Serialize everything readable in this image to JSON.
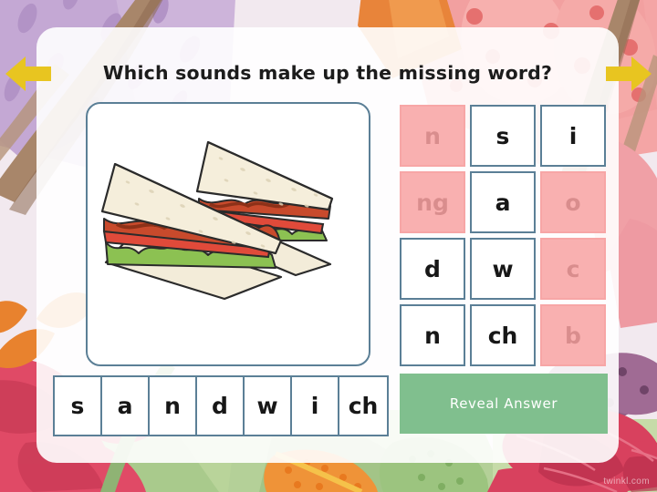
{
  "header": {
    "title": "Which sounds make up the missing word?"
  },
  "navigation": {
    "previous_label": "◀",
    "next_label": "▶"
  },
  "picture": {
    "alt": "sandwich",
    "description": "Two triangular halves of a BLT sandwich with lettuce, tomato and bacon"
  },
  "answer_row": {
    "word": "sandwich",
    "phonemes": [
      "s",
      "a",
      "n",
      "d",
      "w",
      "i",
      "ch"
    ]
  },
  "phoneme_grid": {
    "columns": 3,
    "rows": 4,
    "tiles": [
      {
        "label": "n",
        "state": "pink"
      },
      {
        "label": "s",
        "state": "white"
      },
      {
        "label": "i",
        "state": "white"
      },
      {
        "label": "ng",
        "state": "pink"
      },
      {
        "label": "a",
        "state": "white"
      },
      {
        "label": "o",
        "state": "pink"
      },
      {
        "label": "d",
        "state": "white"
      },
      {
        "label": "w",
        "state": "white"
      },
      {
        "label": "c",
        "state": "pink"
      },
      {
        "label": "n",
        "state": "white"
      },
      {
        "label": "ch",
        "state": "white"
      },
      {
        "label": "b",
        "state": "pink"
      }
    ]
  },
  "reveal": {
    "label": "Reveal Answer"
  },
  "watermark": {
    "label": "twinkl.com"
  },
  "colors": {
    "tile_white_bg": "#ffffff",
    "tile_pink_bg": "#f9b0b0",
    "tile_pink_text": "#d98d8d",
    "tile_border": "#5b7f96",
    "reveal_bg": "#80bf8e",
    "arrow": "#e8c520",
    "card_bg": "#ffffff",
    "title_text": "#1c1c1c"
  }
}
